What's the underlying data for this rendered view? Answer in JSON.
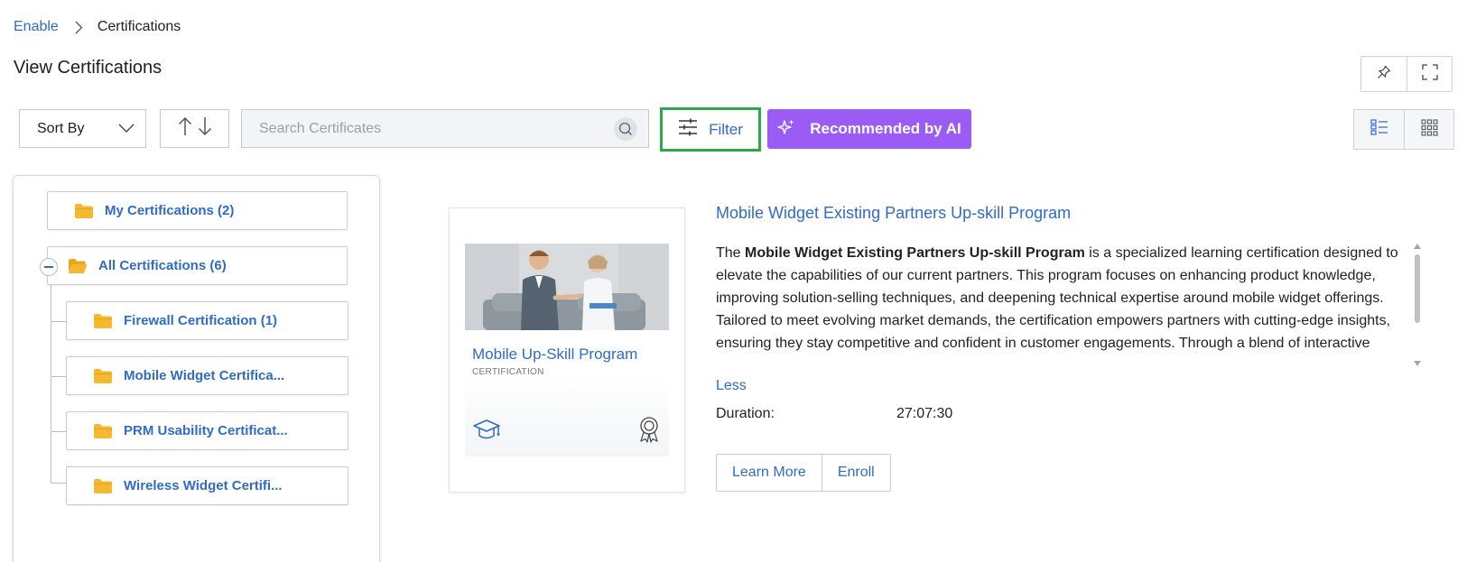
{
  "breadcrumb": {
    "parent": "Enable",
    "current": "Certifications"
  },
  "page_title": "View Certifications",
  "toolbar": {
    "sort_label": "Sort By",
    "search_placeholder": "Search Certificates",
    "filter_label": "Filter",
    "ai_label": "Recommended by AI"
  },
  "tree": {
    "my_certifications": "My Certifications (2)",
    "all_certifications": "All Certifications (6)",
    "children": [
      "Firewall Certification (1)",
      "Mobile Widget Certifica...",
      "PRM Usability Certificat...",
      "Wireless Widget Certifi..."
    ]
  },
  "card": {
    "title": "Mobile Up-Skill Program",
    "type": "CERTIFICATION"
  },
  "detail": {
    "title": "Mobile Widget Existing Partners Up-skill Program",
    "desc_prefix": "The ",
    "desc_bold": "Mobile Widget Existing Partners Up-skill Program",
    "desc_rest": " is a specialized learning certification designed to elevate the capabilities of our current partners. This program focuses on enhancing product knowledge, improving solution-selling techniques, and deepening technical expertise around mobile widget offerings. Tailored to meet evolving market demands, the certification empowers partners with cutting-edge insights, ensuring they stay competitive and confident in customer engagements. Through a blend of interactive modules, real-world use cases, and expert-led sessions, participants",
    "less_label": "Less",
    "duration_label": "Duration:",
    "duration_value": "27:07:30",
    "learn_more_label": "Learn More",
    "enroll_label": "Enroll"
  },
  "colors": {
    "link": "#2f6bc7",
    "ai_button": "#9b5cf5",
    "filter_highlight": "#2aa84a",
    "folder": "#f5b82e"
  }
}
